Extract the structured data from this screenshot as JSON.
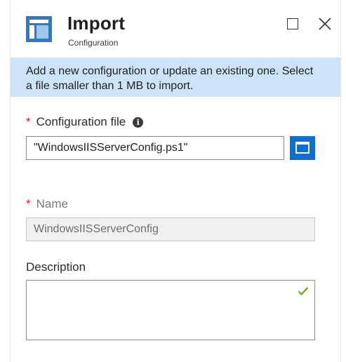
{
  "header": {
    "title": "Import",
    "subtitle": "Configuration",
    "icon": "configuration-blade-icon"
  },
  "window_controls": {
    "maximize_icon": "maximize-icon",
    "close_icon": "close-icon"
  },
  "info_banner": {
    "text": "Add a new configuration or update an existing one. Select a file smaller than 1 MB to import."
  },
  "form": {
    "configuration_file": {
      "required_marker": "*",
      "label": "Configuration file",
      "info_icon": "i",
      "value": "\"WindowsIISServerConfig.ps1\"",
      "browse_icon": "folder-browse-icon"
    },
    "name": {
      "required_marker": "*",
      "label": "Name",
      "value": "WindowsIISServerConfig"
    },
    "description": {
      "label": "Description",
      "value": "",
      "valid_icon": "checkmark-icon"
    }
  },
  "colors": {
    "accent": "#0f6fd1",
    "banner": "#cde3f7",
    "required": "#e81123",
    "valid": "#57a300"
  }
}
